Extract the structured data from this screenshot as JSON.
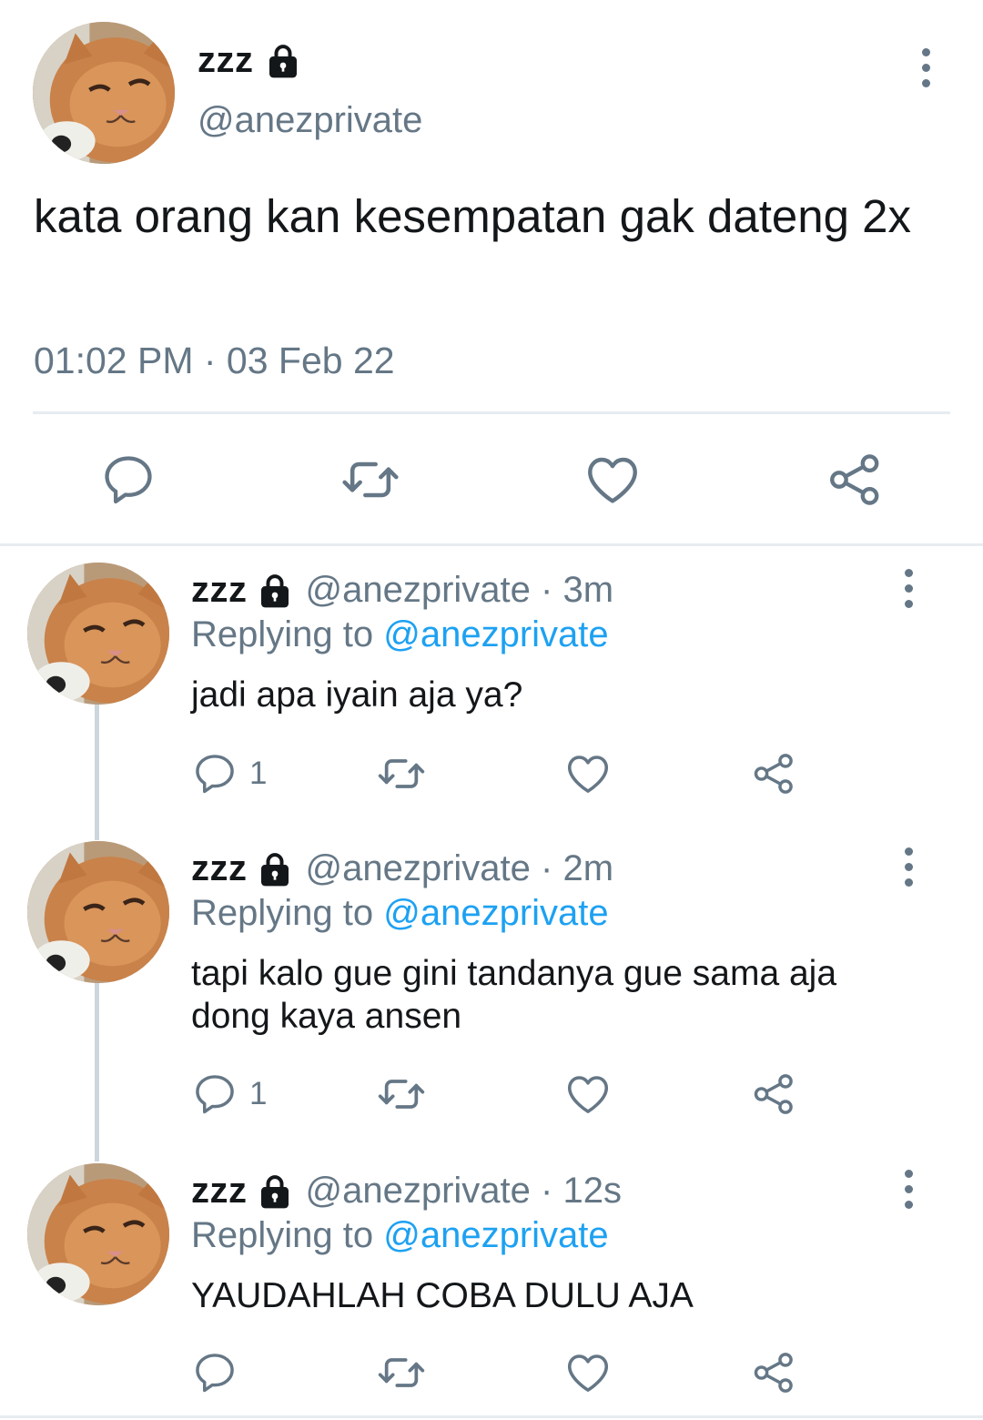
{
  "main_tweet": {
    "name": "zzz",
    "handle": "@anezprivate",
    "text": "kata orang kan kesempatan gak dateng 2x",
    "timestamp": "01:02 PM · 03 Feb 22"
  },
  "replies": [
    {
      "name": "zzz",
      "handle": "@anezprivate · 3m",
      "replying_prefix": "Replying to ",
      "replying_to": "@anezprivate",
      "text": "jadi apa iyain aja ya?",
      "reply_count": "1"
    },
    {
      "name": "zzz",
      "handle": "@anezprivate · 2m",
      "replying_prefix": "Replying to ",
      "replying_to": "@anezprivate",
      "text": "tapi kalo gue gini tandanya gue sama aja dong kaya ansen",
      "reply_count": "1"
    },
    {
      "name": "zzz",
      "handle": "@anezprivate · 12s",
      "replying_prefix": "Replying to ",
      "replying_to": "@anezprivate",
      "text": "YAUDAHLAH COBA DULU AJA",
      "reply_count": ""
    }
  ],
  "colors": {
    "text": "#14171a",
    "secondary": "#657786",
    "link": "#1da1f2",
    "divider": "#e6ecf0"
  },
  "icons": [
    "lock-icon",
    "more-icon",
    "reply-icon",
    "retweet-icon",
    "like-icon",
    "share-icon"
  ]
}
